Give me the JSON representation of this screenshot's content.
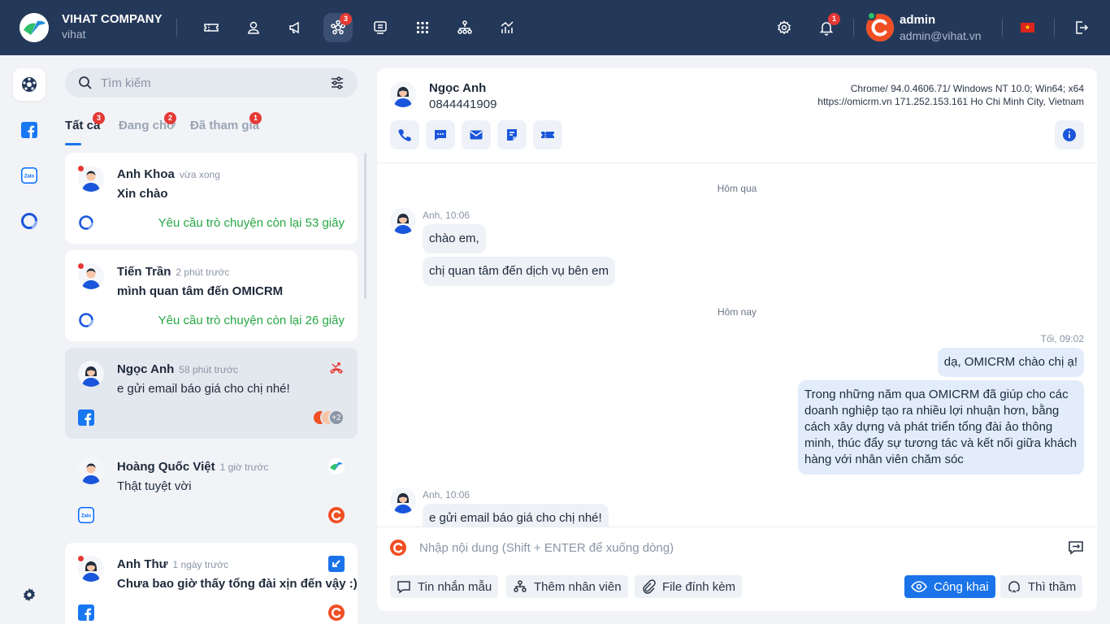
{
  "header": {
    "company_name": "VIHAT COMPANY",
    "company_sub": "vihat",
    "nav_badge": "3",
    "notif_badge": "1",
    "user_name": "admin",
    "user_email": "admin@vihat.vn",
    "nav_items": [
      "ticket-icon",
      "contact-icon",
      "campaign-icon",
      "omnichannel-icon",
      "call-center-icon",
      "apps-icon",
      "org-chart-icon",
      "report-icon"
    ]
  },
  "sidebar": {
    "items": [
      "omnichannel",
      "facebook",
      "zalo",
      "omicrm"
    ],
    "settings": "settings"
  },
  "list": {
    "search_placeholder": "Tìm kiếm",
    "tabs": [
      {
        "label": "Tất cả",
        "badge": "3"
      },
      {
        "label": "Đang chờ",
        "badge": "2"
      },
      {
        "label": "Đã tham gia",
        "badge": "1"
      }
    ],
    "conversations": [
      {
        "name": "Anh Khoa",
        "time": "vừa xong",
        "message": "Xin chào",
        "remaining": "Yêu cầu trò chuyện còn lại 53 giây",
        "channel": "omicrm"
      },
      {
        "name": "Tiến Trần",
        "time": "2 phút trước",
        "message": "mình quan tâm đến OMICRM",
        "remaining": "Yêu cầu trò chuyện còn lại 26 giây",
        "channel": "omicrm"
      },
      {
        "name": "Ngọc Anh",
        "time": "58 phút trước",
        "message": "e gửi email báo giá cho chị nhé!",
        "channel": "facebook",
        "participants_extra": "+2"
      },
      {
        "name": "Hoàng Quốc Việt",
        "time": "1 giờ trước",
        "message": "Thật tuyệt vời",
        "channel": "zalo"
      },
      {
        "name": "Anh Thư",
        "time": "1 ngày trước",
        "message": "Chưa bao giờ thấy tổng đài xịn đến vậy :)",
        "channel": "facebook"
      }
    ]
  },
  "chat": {
    "contact_name": "Ngọc Anh",
    "contact_phone": "0844441909",
    "client_agent": "Chrome/ 94.0.4606.71/ Windows NT 10.0; Win64; x64",
    "client_origin": "https://omicrm.vn 171.252.153.161 Ho Chi Minh City, Vietnam",
    "day_yesterday": "Hôm qua",
    "day_today": "Hôm nay",
    "messages": [
      {
        "meta": "Anh, 10:06",
        "text": "chào em,"
      },
      {
        "text": "chị quan tâm đến dịch vụ bên em"
      },
      {
        "meta": "Tối, 09:02",
        "text": "dạ, OMICRM chào chị ạ!"
      },
      {
        "text": "Trong những năm qua OMICRM đã giúp cho các doanh nghiệp tạo ra nhiều lợi nhuận hơn, bằng cách xây dựng và phát triển tổng đài ảo thông minh, thúc đẩy sự tương tác và kết nối giữa khách hàng với nhân viên chăm sóc"
      },
      {
        "meta": "Anh, 10:06",
        "text": "e gửi email báo giá cho chị nhé!"
      }
    ],
    "input_placeholder": "Nhập nội dung (Shift + ENTER để xuống dòng)",
    "buttons": {
      "template": "Tin nhắn mẫu",
      "add_agent": "Thêm nhân viên",
      "attach": "File đính kèm",
      "public": "Công khai",
      "whisper": "Thì thầm"
    }
  },
  "colors": {
    "topbar": "#243859",
    "accent": "#1a73e8",
    "success": "#27a844",
    "badge": "#e53935"
  }
}
